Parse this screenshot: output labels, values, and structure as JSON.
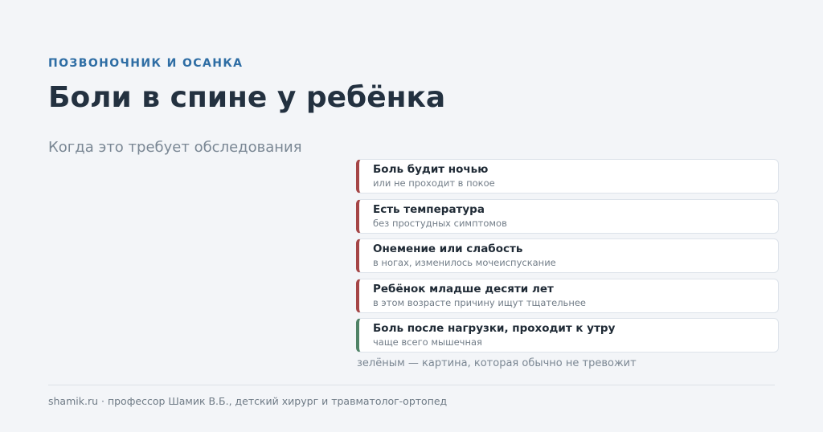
{
  "header": {
    "kicker": "ПОЗВОНОЧНИК И ОСАНКА",
    "title": "Боли в спине у ребёнка",
    "subtitle": "Когда это требует обследования"
  },
  "cards": [
    {
      "title": "Боль будит ночью",
      "subtitle": "или не проходит в покое",
      "status": "red"
    },
    {
      "title": "Есть температура",
      "subtitle": "без простудных симптомов",
      "status": "red"
    },
    {
      "title": "Онемение или слабость",
      "subtitle": "в ногах, изменилось мочеиспускание",
      "status": "red"
    },
    {
      "title": "Ребёнок младше десяти лет",
      "subtitle": "в этом возрасте причину ищут тщательнее",
      "status": "red"
    },
    {
      "title": "Боль после нагрузки, проходит к утру",
      "subtitle": "чаще всего мышечная",
      "status": "green"
    }
  ],
  "note": "зелёным — картина, которая обычно не тревожит",
  "footer": "shamik.ru · профессор Шамик В.Б., детский хирург и травматолог-ортопед",
  "colors": {
    "accent": "#2e6da4",
    "alert": "#a54546",
    "ok": "#4f8266",
    "background": "#f3f5f8"
  }
}
